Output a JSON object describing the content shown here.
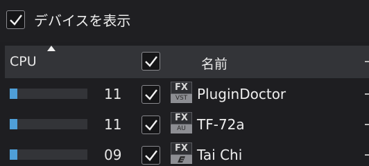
{
  "top": {
    "show_devices_label": "デバイスを表示",
    "show_devices_checked": true
  },
  "header": {
    "cpu_label": "CPU",
    "name_label": "名前",
    "sort": "ascending",
    "select_all_checked": true
  },
  "rows": [
    {
      "cpu_value": "11",
      "cpu_fraction": 0.1,
      "enabled": true,
      "badge_top": "FX",
      "badge_bottom": "VST",
      "name": "PluginDoctor"
    },
    {
      "cpu_value": "11",
      "cpu_fraction": 0.1,
      "enabled": true,
      "badge_top": "FX",
      "badge_bottom": "AU",
      "name": "TF-72a"
    },
    {
      "cpu_value": "09",
      "cpu_fraction": 0.1,
      "enabled": true,
      "badge_top": "FX",
      "badge_bottom": "",
      "name": "Tai Chi"
    }
  ],
  "colors": {
    "cpu_bar": "#4f9fd8",
    "header_bg": "#333438",
    "background": "#1e1e21"
  }
}
